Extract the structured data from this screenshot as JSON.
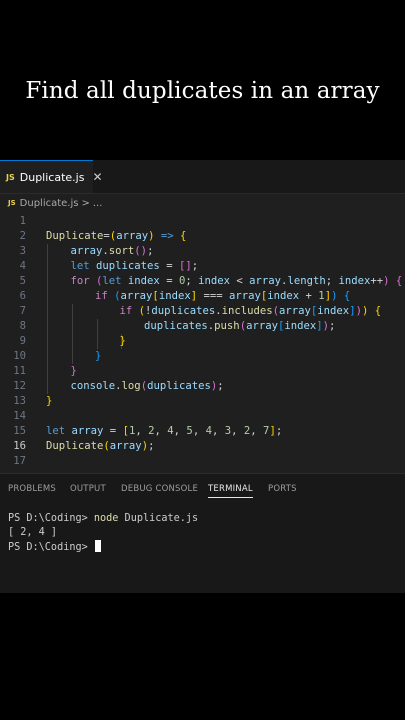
{
  "title": "Find all duplicates in an array",
  "tab": {
    "icon": "JS",
    "label": "Duplicate.js",
    "close": "✕"
  },
  "breadcrumb": {
    "icon": "JS",
    "file": "Duplicate.js",
    "sep": ">",
    "more": "..."
  },
  "code": [
    {
      "n": "1",
      "tokens": []
    },
    {
      "n": "2",
      "tokens": [
        [
          "fn",
          "Duplicate"
        ],
        [
          "",
          "="
        ],
        [
          "b1",
          "("
        ],
        [
          "var",
          "array"
        ],
        [
          "b1",
          ")"
        ],
        [
          "kw",
          " =>"
        ],
        [
          "b1",
          " {"
        ]
      ]
    },
    {
      "n": "3",
      "tokens": [
        [
          "var",
          "array"
        ],
        [
          "",
          "."
        ],
        [
          "fn",
          "sort"
        ],
        [
          "b2",
          "()"
        ],
        [
          ";",
          ";"
        ]
      ]
    },
    {
      "n": "4",
      "tokens": [
        [
          "kw",
          "let"
        ],
        [
          "var",
          " duplicates"
        ],
        [
          "",
          " = "
        ],
        [
          "b2",
          "[]"
        ],
        [
          "",
          ";"
        ]
      ]
    },
    {
      "n": "5",
      "tokens": [
        [
          "ctl",
          "for"
        ],
        [
          "b2",
          " ("
        ],
        [
          "kw",
          "let"
        ],
        [
          "var",
          " index"
        ],
        [
          "",
          " = "
        ],
        [
          "num",
          "0"
        ],
        [
          "",
          "; "
        ],
        [
          "var",
          "index"
        ],
        [
          "",
          " < "
        ],
        [
          "var",
          "array"
        ],
        [
          "",
          "."
        ],
        [
          "var",
          "length"
        ],
        [
          "",
          "; "
        ],
        [
          "var",
          "index"
        ],
        [
          "",
          "++"
        ],
        [
          "b2",
          ")"
        ],
        [
          "b2",
          " {"
        ]
      ]
    },
    {
      "n": "6",
      "tokens": [
        [
          "ctl",
          "if"
        ],
        [
          "b3",
          " ("
        ],
        [
          "var",
          "array"
        ],
        [
          "b1",
          "["
        ],
        [
          "var",
          "index"
        ],
        [
          "b1",
          "]"
        ],
        [
          "",
          " === "
        ],
        [
          "var",
          "array"
        ],
        [
          "b1",
          "["
        ],
        [
          "var",
          "index"
        ],
        [
          "",
          " + "
        ],
        [
          "num",
          "1"
        ],
        [
          "b1",
          "]"
        ],
        [
          "b3",
          ")"
        ],
        [
          "b3",
          " {"
        ]
      ]
    },
    {
      "n": "7",
      "tokens": [
        [
          "ctl",
          "if"
        ],
        [
          "b1",
          " ("
        ],
        [
          "",
          "!"
        ],
        [
          "var",
          "duplicates"
        ],
        [
          "",
          "."
        ],
        [
          "fn",
          "includes"
        ],
        [
          "b2",
          "("
        ],
        [
          "var",
          "array"
        ],
        [
          "b3",
          "["
        ],
        [
          "var",
          "index"
        ],
        [
          "b3",
          "]"
        ],
        [
          "b2",
          ")"
        ],
        [
          "b1",
          ")"
        ],
        [
          "b1",
          " {"
        ]
      ]
    },
    {
      "n": "8",
      "tokens": [
        [
          "var",
          "duplicates"
        ],
        [
          "",
          "."
        ],
        [
          "fn",
          "push"
        ],
        [
          "b2",
          "("
        ],
        [
          "var",
          "array"
        ],
        [
          "b3",
          "["
        ],
        [
          "var",
          "index"
        ],
        [
          "b3",
          "]"
        ],
        [
          "b2",
          ")"
        ],
        [
          "",
          ";"
        ]
      ]
    },
    {
      "n": "9",
      "tokens": [
        [
          "b1",
          "}"
        ]
      ]
    },
    {
      "n": "10",
      "tokens": [
        [
          "b3",
          "}"
        ]
      ]
    },
    {
      "n": "11",
      "tokens": [
        [
          "b2",
          "}"
        ]
      ]
    },
    {
      "n": "12",
      "tokens": [
        [
          "var",
          "console"
        ],
        [
          "",
          "."
        ],
        [
          "fn",
          "log"
        ],
        [
          "b2",
          "("
        ],
        [
          "var",
          "duplicates"
        ],
        [
          "b2",
          ")"
        ],
        [
          "",
          ";"
        ]
      ]
    },
    {
      "n": "13",
      "tokens": [
        [
          "b1",
          "}"
        ]
      ]
    },
    {
      "n": "14",
      "tokens": []
    },
    {
      "n": "15",
      "tokens": [
        [
          "kw",
          "let"
        ],
        [
          "var",
          " array"
        ],
        [
          "",
          " = "
        ],
        [
          "b1",
          "["
        ],
        [
          "num",
          "1"
        ],
        [
          ", ",
          ", "
        ],
        [
          "num",
          "2"
        ],
        [
          ", ",
          ", "
        ],
        [
          "num",
          "4"
        ],
        [
          ", ",
          ", "
        ],
        [
          "num",
          "5"
        ],
        [
          ", ",
          ", "
        ],
        [
          "num",
          "4"
        ],
        [
          ", ",
          ", "
        ],
        [
          "num",
          "3"
        ],
        [
          ", ",
          ", "
        ],
        [
          "num",
          "2"
        ],
        [
          ", ",
          ", "
        ],
        [
          "num",
          "7"
        ],
        [
          "b1",
          "]"
        ],
        [
          "",
          ";"
        ]
      ]
    },
    {
      "n": "16",
      "tokens": [
        [
          "fn",
          "Duplicate"
        ],
        [
          "b1",
          "("
        ],
        [
          "var",
          "array"
        ],
        [
          "b1",
          ")"
        ],
        [
          "",
          ";"
        ]
      ]
    },
    {
      "n": "17",
      "tokens": []
    }
  ],
  "panel_tabs": [
    "PROBLEMS",
    "OUTPUT",
    "DEBUG CONSOLE",
    "TERMINAL",
    "PORTS"
  ],
  "terminal": {
    "prompt1": "PS D:\\Coding> ",
    "command": "node",
    "args": " Duplicate.js",
    "output": "[ 2, 4 ]",
    "prompt2": "PS D:\\Coding> "
  }
}
